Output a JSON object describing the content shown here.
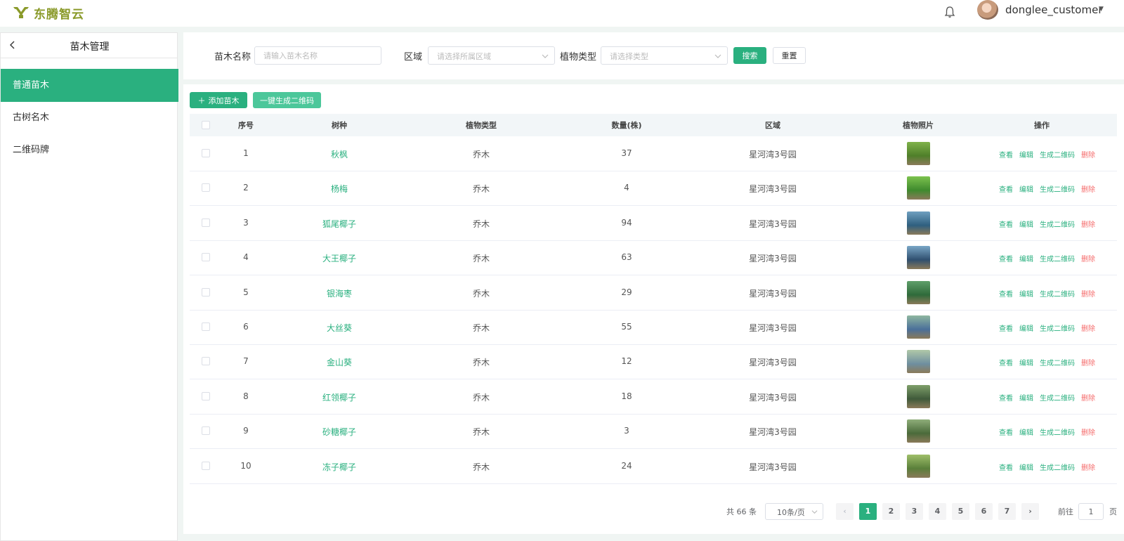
{
  "header": {
    "logo_text": "东腾智云",
    "username": "donglee_customer"
  },
  "sidebar": {
    "title": "苗木管理",
    "items": [
      {
        "label": "普通苗木",
        "active": true
      },
      {
        "label": "古树名木",
        "active": false
      },
      {
        "label": "二维码牌",
        "active": false
      }
    ]
  },
  "search": {
    "name_label": "苗木名称",
    "name_placeholder": "请输入苗木名称",
    "area_label": "区域",
    "area_placeholder": "请选择所属区域",
    "type_label": "植物类型",
    "type_placeholder": "请选择类型",
    "search_button": "搜索",
    "reset_button": "重置"
  },
  "toolbar": {
    "add_button": "添加苗木",
    "qr_button": "一键生成二维码"
  },
  "table": {
    "columns": [
      "序号",
      "树种",
      "植物类型",
      "数量(株)",
      "区域",
      "植物照片",
      "操作"
    ],
    "actions": {
      "view": "查看",
      "edit": "编辑",
      "qrcode": "生成二维码",
      "delete": "删除"
    },
    "rows": [
      {
        "no": "1",
        "species": "秋枫",
        "type": "乔木",
        "count": "37",
        "area": "星河湾3号园"
      },
      {
        "no": "2",
        "species": "杨梅",
        "type": "乔木",
        "count": "4",
        "area": "星河湾3号园"
      },
      {
        "no": "3",
        "species": "狐尾椰子",
        "type": "乔木",
        "count": "94",
        "area": "星河湾3号园"
      },
      {
        "no": "4",
        "species": "大王椰子",
        "type": "乔木",
        "count": "63",
        "area": "星河湾3号园"
      },
      {
        "no": "5",
        "species": "银海枣",
        "type": "乔木",
        "count": "29",
        "area": "星河湾3号园"
      },
      {
        "no": "6",
        "species": "大丝葵",
        "type": "乔木",
        "count": "55",
        "area": "星河湾3号园"
      },
      {
        "no": "7",
        "species": "金山葵",
        "type": "乔木",
        "count": "12",
        "area": "星河湾3号园"
      },
      {
        "no": "8",
        "species": "红领椰子",
        "type": "乔木",
        "count": "18",
        "area": "星河湾3号园"
      },
      {
        "no": "9",
        "species": "砂糖椰子",
        "type": "乔木",
        "count": "3",
        "area": "星河湾3号园"
      },
      {
        "no": "10",
        "species": "冻子椰子",
        "type": "乔木",
        "count": "24",
        "area": "星河湾3号园"
      }
    ]
  },
  "pagination": {
    "total_text": "共 66 条",
    "page_size": "10条/页",
    "pages": [
      "1",
      "2",
      "3",
      "4",
      "5",
      "6",
      "7"
    ],
    "current": "1",
    "goto_label": "前往",
    "goto_value": "1",
    "goto_suffix": "页"
  },
  "colors": {
    "accent": "#2ab07f",
    "danger": "#f56c6c"
  }
}
